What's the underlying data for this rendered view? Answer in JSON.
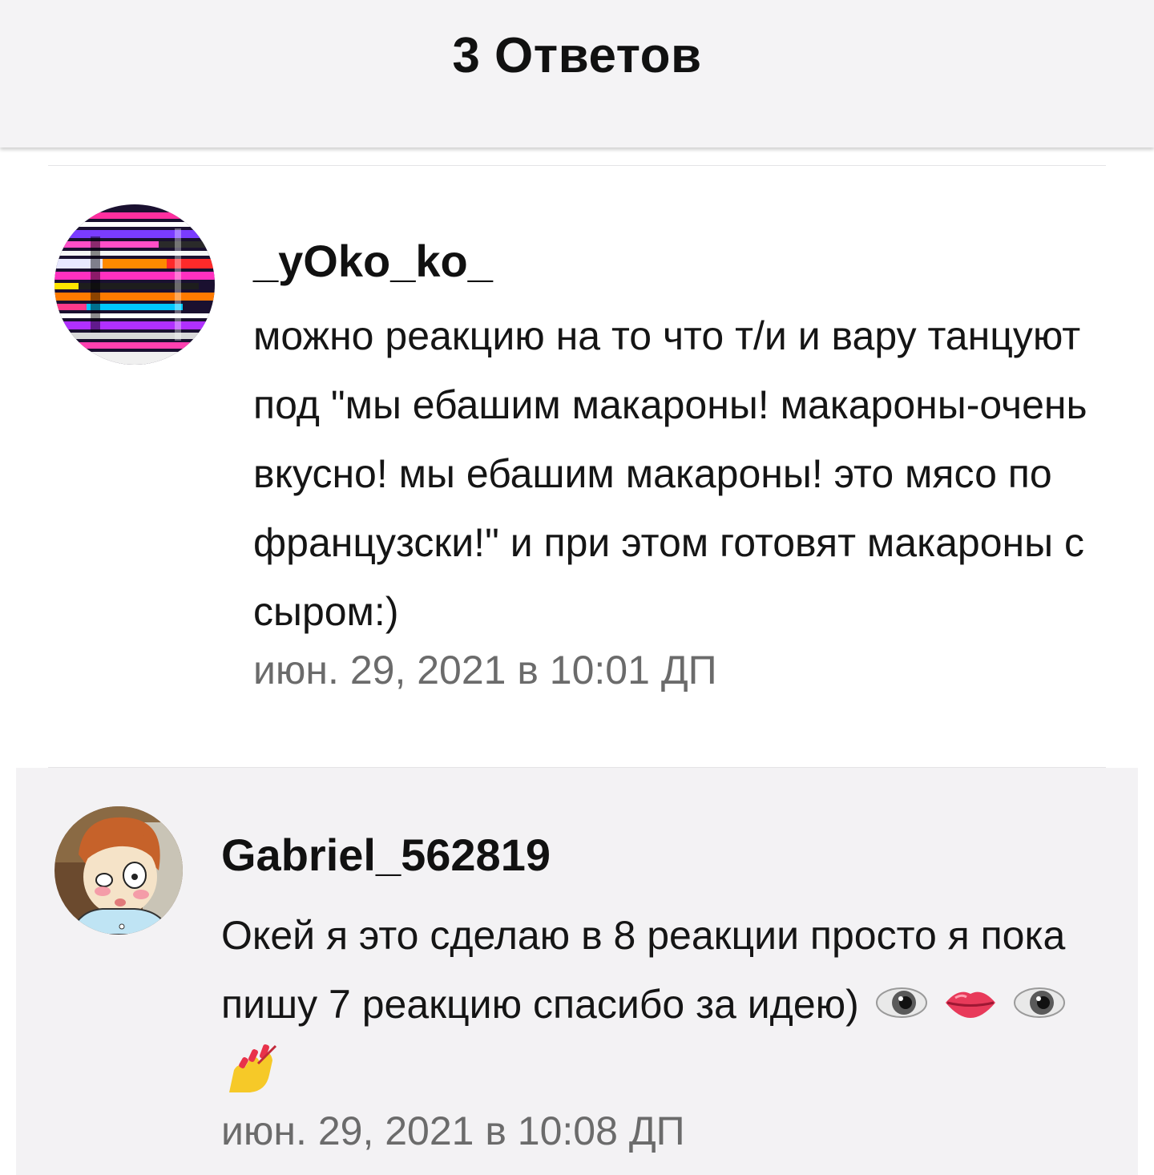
{
  "header": {
    "title": "3 Ответов"
  },
  "comments": [
    {
      "username": "_yOko_ko_",
      "text": "можно реакцию на то что т/и и вару танцуют под \"мы ебашим макароны! макароны-очень вкусно! мы ебашим макароны! это мясо по французски!\" и при этом готовят макароны с сыром:)",
      "timestamp": "июн. 29, 2021 в 10:01 ДП",
      "avatar_icon": "glitch-art-avatar"
    },
    {
      "username": "Gabriel_562819",
      "text": "Окей я это сделаю в 8 реакции просто я пока пишу 7 реакцию спасибо за идею)",
      "emojis": [
        "eye-emoji",
        "lips-emoji",
        "eye-emoji",
        "nail-polish-emoji"
      ],
      "timestamp": "июн. 29, 2021 в 10:08 ДП",
      "avatar_icon": "cartoon-character-avatar"
    }
  ],
  "colors": {
    "header_bg": "#f4f3f5",
    "highlight_bg": "#f3f2f4",
    "timestamp": "#6b6b6b"
  }
}
